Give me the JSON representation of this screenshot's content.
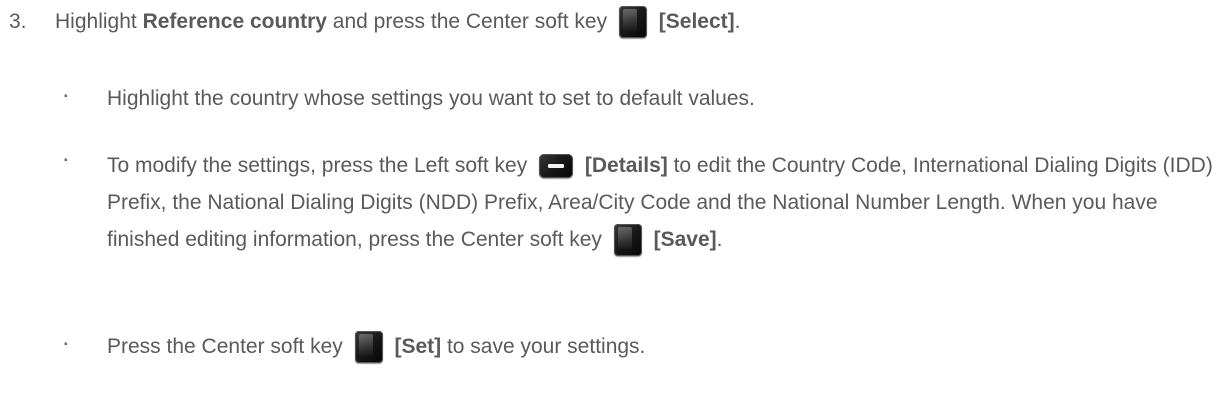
{
  "step": {
    "number": "3.",
    "text_before": "Highlight ",
    "bold_term": "Reference country",
    "text_mid": " and press the Center soft key ",
    "key_label": "[Select]",
    "text_end": "."
  },
  "bullets": [
    {
      "text": "Highlight the country whose settings you want to set to default values."
    },
    {
      "text_before": "To modify the settings, press the Left soft key ",
      "key_label": "[Details]",
      "text_after": " to edit the Country Code, International Dialing Digits (IDD) Prefix, the National Dialing Digits (NDD) Prefix, Area/City Code and the National Number Length. When you have finished editing information, press the Center soft key ",
      "key2_label": "[Save]",
      "text_end": "."
    },
    {
      "text_before": "Press the Center soft key ",
      "key_label": "[Set]",
      "text_after": " to save your settings."
    }
  ],
  "bullet_glyph": "▪",
  "icons": {
    "center_key": "center-soft-key-icon",
    "left_key": "left-soft-key-icon"
  }
}
